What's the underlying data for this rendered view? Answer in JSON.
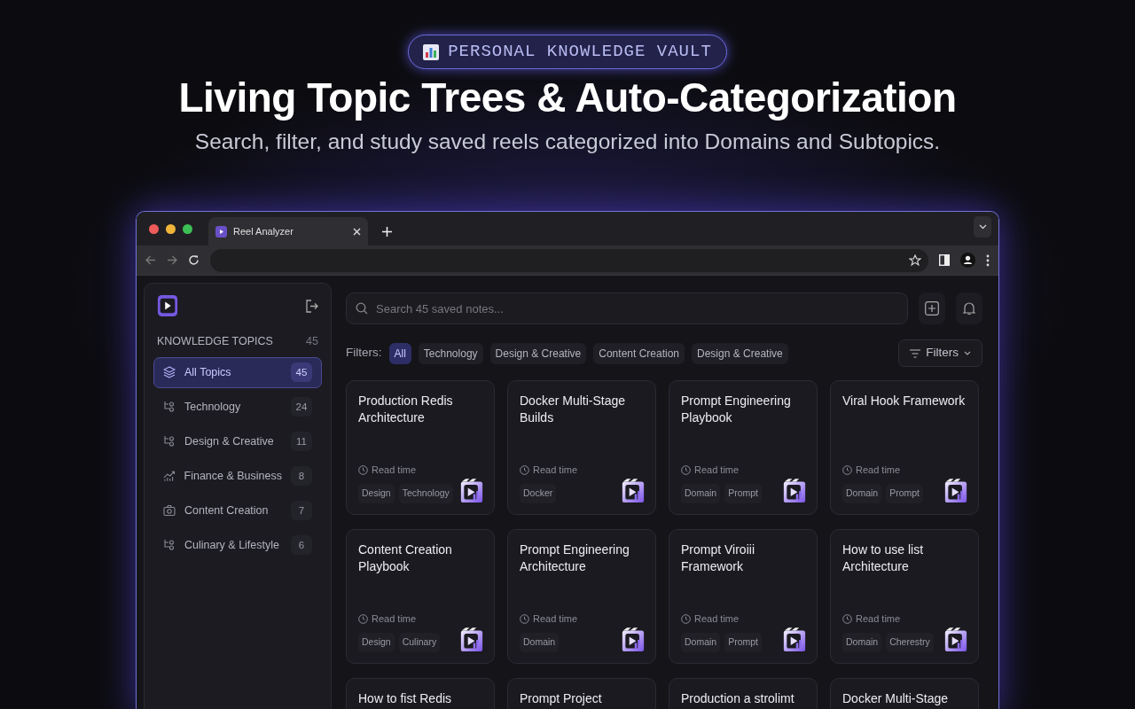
{
  "hero": {
    "badge": "PERSONAL KNOWLEDGE VAULT",
    "title": "Living Topic Trees & Auto-Categorization",
    "subtitle": "Search, filter, and study saved reels categorized into Domains and Subtopics."
  },
  "browser": {
    "tab_title": "Reel Analyzer"
  },
  "sidebar": {
    "heading": "KNOWLEDGE TOPICS",
    "heading_count": "45",
    "items": [
      {
        "label": "All Topics",
        "count": "45",
        "kind": "all",
        "selected": true
      },
      {
        "label": "Technology",
        "count": "24",
        "kind": "branch",
        "selected": false
      },
      {
        "label": "Design & Creative",
        "count": "11",
        "kind": "branch",
        "selected": false
      },
      {
        "label": "Finance & Business",
        "count": "8",
        "kind": "chart",
        "selected": false
      },
      {
        "label": "Content Creation",
        "count": "7",
        "kind": "camera",
        "selected": false
      },
      {
        "label": "Culinary & Lifestyle",
        "count": "6",
        "kind": "branch",
        "selected": false
      }
    ]
  },
  "search": {
    "placeholder": "Search 45 saved notes..."
  },
  "filters": {
    "label": "Filters:",
    "button": "Filters",
    "chips": [
      {
        "label": "All",
        "selected": true
      },
      {
        "label": "Technology",
        "selected": false
      },
      {
        "label": "Design & Creative",
        "selected": false
      },
      {
        "label": "Content Creation",
        "selected": false
      },
      {
        "label": "Design & Creative",
        "selected": false
      }
    ]
  },
  "cards": [
    {
      "title": "Production Redis Architecture",
      "meta": "Read time",
      "tags": [
        "Design",
        "Technology"
      ]
    },
    {
      "title": "Docker Multi-Stage Builds",
      "meta": "Read time",
      "tags": [
        "Docker"
      ]
    },
    {
      "title": "Prompt Engineering Playbook",
      "meta": "Read time",
      "tags": [
        "Domain",
        "Prompt"
      ]
    },
    {
      "title": "Viral Hook Framework",
      "meta": "Read time",
      "tags": [
        "Domain",
        "Prompt"
      ]
    },
    {
      "title": "Content Creation Playbook",
      "meta": "Read time",
      "tags": [
        "Design",
        "Culinary"
      ]
    },
    {
      "title": "Prompt Engineering Architecture",
      "meta": "Read time",
      "tags": [
        "Domain"
      ]
    },
    {
      "title": "Prompt Viroiii Framework",
      "meta": "Read time",
      "tags": [
        "Domain",
        "Prompt"
      ]
    },
    {
      "title": "How to use list Architecture",
      "meta": "Read time",
      "tags": [
        "Domain",
        "Cherestry"
      ]
    },
    {
      "title": "How to fist Redis"
    },
    {
      "title": "Prompt Project"
    },
    {
      "title": "Production a strolimt"
    },
    {
      "title": "Docker Multi-Stage"
    }
  ]
}
